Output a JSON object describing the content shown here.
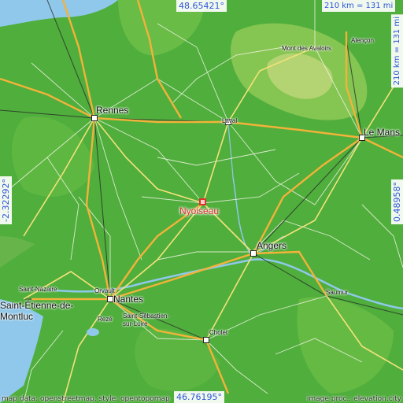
{
  "map": {
    "target": {
      "name": "Nyoiseau"
    },
    "cities": [
      {
        "key": "rennes",
        "name": "Rennes"
      },
      {
        "key": "laval",
        "name": "Laval"
      },
      {
        "key": "le_mans",
        "name": "Le Mans"
      },
      {
        "key": "angers",
        "name": "Angers"
      },
      {
        "key": "nantes",
        "name": "Nantes"
      },
      {
        "key": "cholet",
        "name": "Cholet"
      },
      {
        "key": "saumur",
        "name": "Saumur"
      },
      {
        "key": "alencon",
        "name": "Alençon"
      },
      {
        "key": "saint_nazaire",
        "name": "Saint-Nazaire"
      },
      {
        "key": "saint_etienne",
        "name": "Saint-Étienne-de-\nMontluc"
      },
      {
        "key": "orvault",
        "name": "Orvault"
      },
      {
        "key": "reze",
        "name": "Rezé"
      },
      {
        "key": "saint_sebastien",
        "name": "Saint-Sébastien-\nsur-Loire"
      },
      {
        "key": "mont_avaloirs",
        "name": "Mont des Avaloirs"
      }
    ],
    "coordinates": {
      "top": "48.65421°",
      "bottom": "46.76195°",
      "left": "-2.32292°",
      "right": "0.48958°"
    },
    "scale": {
      "horizontal": "210 km = 131 mi",
      "vertical": "210 km = 131 mi"
    },
    "attribution": {
      "left": "map data: openstreetmap, style: opentopomap",
      "right": "image proc.: elevation.city"
    },
    "colors": {
      "land": "#4fae3c",
      "highland": "#9ccf5a",
      "water": "#8fc8ea",
      "motorway": "#f2b33a",
      "road": "#f4e27a",
      "label": "#e0322e",
      "coordinate": "#2c55d6"
    }
  }
}
